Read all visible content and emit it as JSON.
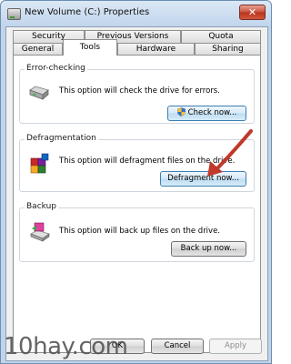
{
  "window": {
    "title": "New Volume (C:) Properties",
    "close_symbol": "✕"
  },
  "tabs": {
    "row1": [
      "Security",
      "Previous Versions",
      "Quota"
    ],
    "row2": [
      "General",
      "Tools",
      "Hardware",
      "Sharing"
    ],
    "active": "Tools"
  },
  "error_checking": {
    "title": "Error-checking",
    "description": "This option will check the drive for errors.",
    "button": "Check now..."
  },
  "defragmentation": {
    "title": "Defragmentation",
    "description": "This option will defragment files on the drive.",
    "button": "Defragment now..."
  },
  "backup": {
    "title": "Backup",
    "description": "This option will back up files on the drive.",
    "button": "Back up now..."
  },
  "footer": {
    "ok": "OK",
    "cancel": "Cancel",
    "apply": "Apply"
  },
  "watermark": "10hay.com",
  "colors": {
    "annotation_arrow": "#c0392b",
    "title_bar": "#c6d9ee"
  },
  "icons": {
    "title": "drive-icon",
    "error_checking": "hard-drive-icon",
    "defragmentation": "defrag-icon",
    "backup": "backup-icon",
    "check_button": "uac-shield-icon"
  }
}
